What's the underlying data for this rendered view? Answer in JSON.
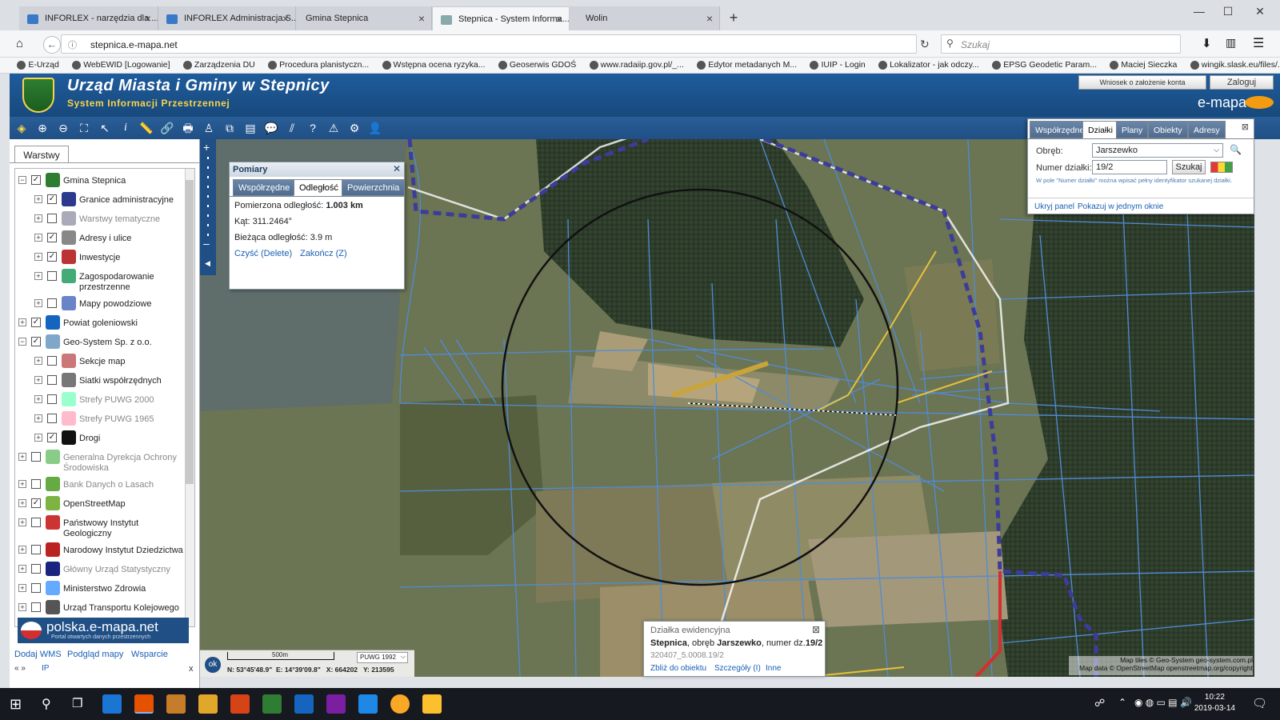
{
  "browser": {
    "tabs": [
      {
        "label": "INFORLEX - narzędzia dla ...",
        "active": false
      },
      {
        "label": "INFORLEX Administracja S...",
        "active": false
      },
      {
        "label": "Gmina Stepnica",
        "active": false
      },
      {
        "label": "Stepnica - System Informa...",
        "active": true
      },
      {
        "label": "Wolin",
        "active": false
      }
    ],
    "url": "stepnica.e-mapa.net",
    "search_placeholder": "Szukaj",
    "bookmarks": [
      "E-Urząd",
      "WebEWID [Logowanie]",
      "Zarządzenia DU",
      "Procedura planistyczn...",
      "Wstępna ocena ryzyka...",
      "Geoserwis GDOŚ",
      "www.radaiip.gov.pl/_...",
      "Edytor metadanych M...",
      "IUIP - Login",
      "Lokalizator - jak odczy...",
      "EPSG Geodetic Param...",
      "Maciej Sieczka",
      "wingik.slask.eu/files/..."
    ]
  },
  "header": {
    "title": "Urząd Miasta i Gminy w Stepnicy",
    "subtitle": "System Informacji Przestrzennej",
    "wniosek_button": "Wniosek o założenie konta",
    "login_button": "Zaloguj",
    "logo": "e-mapa"
  },
  "left_panel": {
    "tab": "Warstwy",
    "layers": [
      {
        "label": "Gmina Stepnica",
        "level": 0,
        "checked": true,
        "expanded": true,
        "gray": false,
        "icon_color": "#2e7d32"
      },
      {
        "label": "Granice administracyjne",
        "level": 1,
        "checked": true,
        "gray": false,
        "icon_color": "#2b3a8c"
      },
      {
        "label": "Warstwy tematyczne",
        "level": 1,
        "checked": false,
        "gray": true,
        "icon_color": "#aab"
      },
      {
        "label": "Adresy i ulice",
        "level": 1,
        "checked": true,
        "gray": false,
        "icon_color": "#888"
      },
      {
        "label": "Inwestycje",
        "level": 1,
        "checked": true,
        "gray": false,
        "icon_color": "#b33"
      },
      {
        "label": "Zagospodarowanie przestrzenne",
        "level": 1,
        "checked": false,
        "gray": false,
        "icon_color": "#4a7"
      },
      {
        "label": "Mapy powodziowe",
        "level": 1,
        "checked": false,
        "gray": false,
        "icon_color": "#6a84c8"
      },
      {
        "label": "Powiat goleniowski",
        "level": 0,
        "checked": true,
        "gray": false,
        "icon_color": "#1565c0"
      },
      {
        "label": "Geo-System Sp. z o.o.",
        "level": 0,
        "checked": true,
        "expanded": true,
        "gray": false,
        "icon_color": "#7fa7c9"
      },
      {
        "label": "Sekcje map",
        "level": 1,
        "checked": false,
        "gray": false,
        "icon_color": "#c77"
      },
      {
        "label": "Siatki współrzędnych",
        "level": 1,
        "checked": false,
        "gray": false,
        "icon_color": "#777"
      },
      {
        "label": "Strefy PUWG 2000",
        "level": 1,
        "checked": false,
        "gray": true,
        "icon_color": "#9fc"
      },
      {
        "label": "Strefy PUWG 1965",
        "level": 1,
        "checked": false,
        "gray": true,
        "icon_color": "#fbc"
      },
      {
        "label": "Drogi",
        "level": 1,
        "checked": true,
        "gray": false,
        "icon_color": "#111"
      },
      {
        "label": "Generalna Dyrekcja Ochrony Środowiska",
        "level": 0,
        "checked": false,
        "gray": true,
        "icon_color": "#8c8"
      },
      {
        "label": "Bank Danych o Lasach",
        "level": 0,
        "checked": false,
        "gray": true,
        "icon_color": "#6a4"
      },
      {
        "label": "OpenStreetMap",
        "level": 0,
        "checked": true,
        "gray": false,
        "icon_color": "#7cb342"
      },
      {
        "label": "Państwowy Instytut Geologiczny",
        "level": 0,
        "checked": false,
        "gray": false,
        "icon_color": "#c33"
      },
      {
        "label": "Narodowy Instytut Dziedzictwa",
        "level": 0,
        "checked": false,
        "gray": false,
        "icon_color": "#b22"
      },
      {
        "label": "Główny Urząd Statystyczny",
        "level": 0,
        "checked": false,
        "gray": true,
        "icon_color": "#1a237e"
      },
      {
        "label": "Ministerstwo Zdrowia",
        "level": 0,
        "checked": false,
        "gray": false,
        "icon_color": "#6af"
      },
      {
        "label": "Urząd Transportu Kolejowego",
        "level": 0,
        "checked": false,
        "gray": false,
        "icon_color": "#555"
      }
    ],
    "banner": {
      "name": "polska.e-mapa.net",
      "sub": "Portal otwartych danych przestrzennych"
    },
    "links": [
      "Dodaj WMS",
      "Podgląd mapy",
      "Wsparcie"
    ],
    "footer_link": "IP",
    "footer_close": "x",
    "footer_arrows": "« »"
  },
  "pomiary": {
    "title": "Pomiary",
    "tabs": [
      "Współrzędne",
      "Odległość",
      "Powierzchnia"
    ],
    "active_tab": 1,
    "measured_label": "Pomierzona odległość:",
    "measured_value": "1.003 km",
    "angle": "Kąt: 311.2464°",
    "current": "Bieżąca odległość: 3.9 m",
    "clear_link": "Czyść (Delete)",
    "finish_link": "Zakończ (Z)"
  },
  "dzialki": {
    "tabs": [
      "Współrzędne",
      "Działki",
      "Plany",
      "Obiekty",
      "Adresy"
    ],
    "active_tab": 1,
    "obreb_label": "Obręb:",
    "obreb_value": "Jarszewko",
    "numer_label": "Numer działki:",
    "numer_value": "19/2",
    "search_button": "Szukaj",
    "note": "W pole \"Numer działki\" można wpisać pełny identyfikator szukanej działki.",
    "hide_link": "Ukryj panel",
    "show_link": "Pokazuj w jednym oknie"
  },
  "parcel_popup": {
    "title": "Działka ewidencyjna",
    "name": "Stepnica",
    "mid1": ", obręb ",
    "obreb": "Jarszewko",
    "mid2": ", numer dz.",
    "number": "19/2",
    "id": "320407_5.0008.19/2",
    "links": [
      "Zbliż do obiektu",
      "Szczegóły (I)",
      "Inne"
    ]
  },
  "status": {
    "scale": "500m",
    "crs": "PUWG 1992",
    "ok": "ok",
    "coords": "N: 53°45'48.9\"  E: 14°39'09.8\"   X: 664202   Y: 213595"
  },
  "attribution": {
    "line1": "Map tiles © Geo-System geo-system.com.pl",
    "line2": "Map data © OpenStreetMap openstreetmap.org/copyright"
  },
  "taskbar": {
    "time": "10:22",
    "date": "2019-03-14"
  }
}
